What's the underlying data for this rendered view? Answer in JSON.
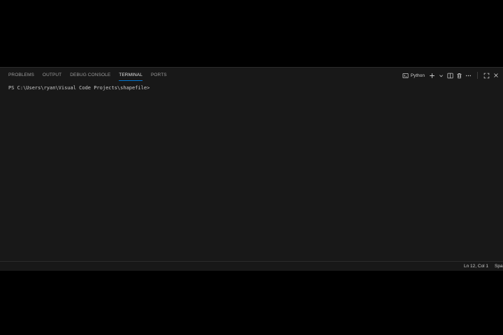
{
  "panel": {
    "tabs": [
      {
        "label": "PROBLEMS",
        "active": false
      },
      {
        "label": "OUTPUT",
        "active": false
      },
      {
        "label": "DEBUG CONSOLE",
        "active": false
      },
      {
        "label": "TERMINAL",
        "active": true
      },
      {
        "label": "PORTS",
        "active": false
      }
    ],
    "terminal_profile": "Python",
    "icons": [
      "terminal-icon",
      "plus-icon",
      "chevron-down-icon",
      "split-icon",
      "trash-icon",
      "more-icon",
      "maximize-icon",
      "close-icon"
    ]
  },
  "terminal": {
    "prompt": "PS C:\\Users\\ryan\\Visual Code Projects\\shapefile>"
  },
  "statusbar": {
    "cursor_position": "Ln 12, Col 1",
    "indentation": "Spa"
  },
  "colors": {
    "background": "#181818",
    "accent": "#0078d4",
    "text": "#cccccc"
  }
}
